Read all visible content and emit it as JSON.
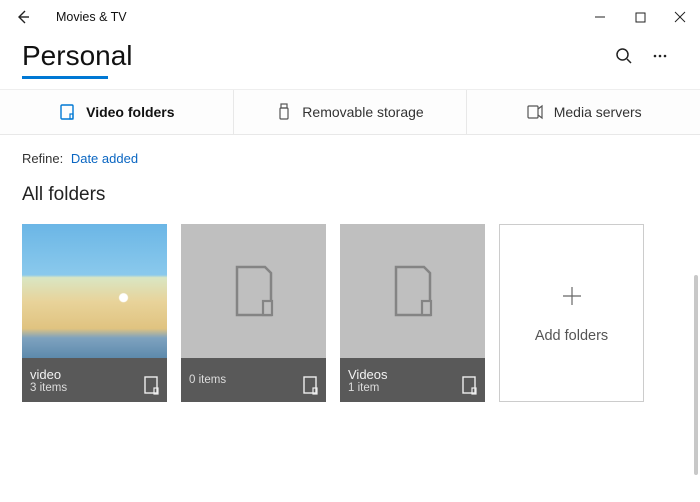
{
  "app": {
    "title": "Movies & TV"
  },
  "page": {
    "title": "Personal"
  },
  "tabs": {
    "video_folders": "Video folders",
    "removable": "Removable storage",
    "media_servers": "Media servers"
  },
  "refine": {
    "label": "Refine:",
    "value": "Date added"
  },
  "section": {
    "title": "All folders"
  },
  "folders": [
    {
      "name": "video",
      "count": "3 items"
    },
    {
      "name": "",
      "count": "0 items"
    },
    {
      "name": "Videos",
      "count": "1 item"
    }
  ],
  "add": {
    "label": "Add folders"
  }
}
